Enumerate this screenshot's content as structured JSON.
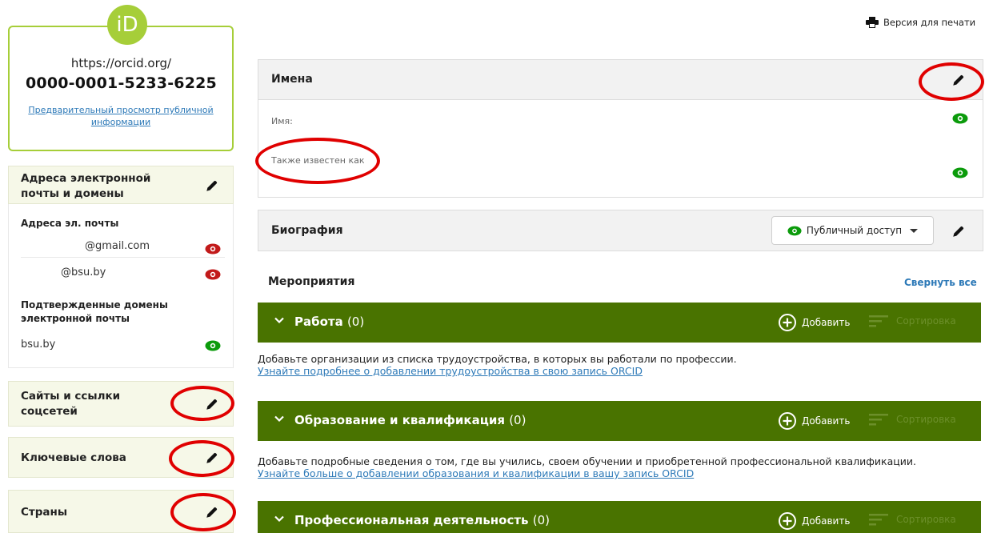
{
  "profile": {
    "logo_text": "iD",
    "url": "https://orcid.org/",
    "id": "0000-0001-5233-6225",
    "preview_link": "Предварительный просмотр публичной информации"
  },
  "sidebar": {
    "email_panel": {
      "title": "Адреса электронной почты и домены",
      "emails_heading": "Адреса эл. почты",
      "emails": [
        "@gmail.com",
        "@bsu.by"
      ],
      "domains_heading": "Подтвержденные домены электронной почты",
      "domain": "bsu.by"
    },
    "sites_title": "Сайты и ссылки соцсетей",
    "keywords_title": "Ключевые слова",
    "countries_title": "Страны"
  },
  "header": {
    "print_label": "Версия для печати"
  },
  "names": {
    "title": "Имена",
    "name_label": "Имя:",
    "aka_label": "Также известен как"
  },
  "bio": {
    "title": "Биография",
    "access_label": "Публичный доступ"
  },
  "activities": {
    "title": "Мероприятия",
    "collapse_all": "Свернуть все",
    "add_label": "Добавить",
    "sort_label": "Сортировка",
    "sections": [
      {
        "name": "Работа",
        "count": "(0)",
        "desc": "Добавьте организации из списка трудоустройства, в которых вы работали по профессии.",
        "link": "Узнайте подробнее о добавлении трудоустройства в свою запись ORCID"
      },
      {
        "name": "Образование и квалификация",
        "count": "(0)",
        "desc": "Добавьте подробные сведения о том, где вы учились, своем обучении и приобретенной профессиональной квалификации.",
        "link": "Узнайте больше о добавлении образования и квалификации в вашу запись ORCID"
      },
      {
        "name": "Профессиональная деятельность",
        "count": "(0)"
      }
    ]
  },
  "colors": {
    "orcid_green": "#a6ce39",
    "section_green": "#497300",
    "link_blue": "#2e7ab8",
    "public_eye": "#0b9b0b",
    "private_eye": "#c21a1a",
    "annotation_red": "#e00000"
  }
}
